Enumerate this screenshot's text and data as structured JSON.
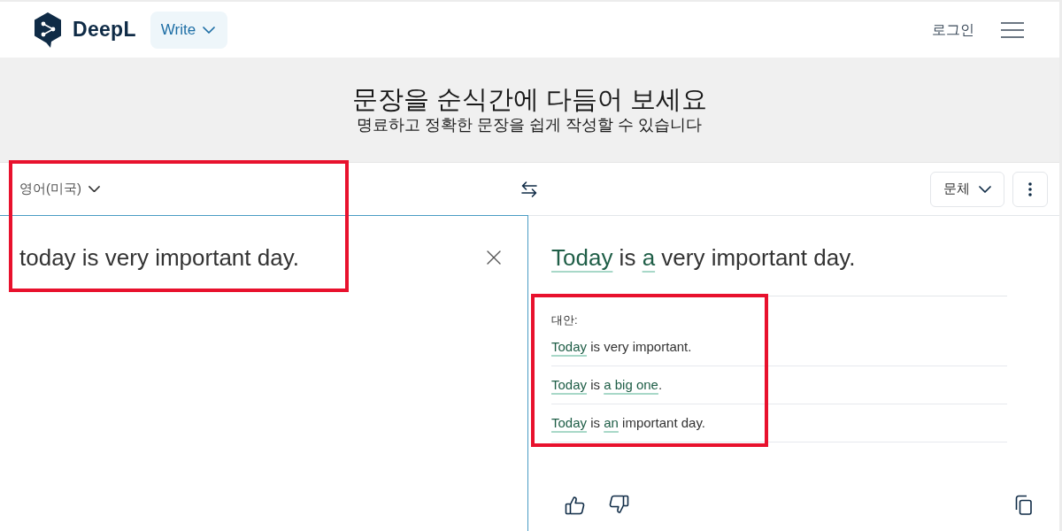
{
  "header": {
    "logo_text": "DeepL",
    "mode_button": "Write",
    "login": "로그인"
  },
  "hero": {
    "title": "문장을 순식간에 다듬어 보세요",
    "subtitle": "명료하고 정확한 문장을 쉽게 작성할 수 있습니다"
  },
  "source": {
    "language": "영어(미국)",
    "text": "today is very important day.",
    "highlighted": true
  },
  "result": {
    "style_button": "문체",
    "sentence": [
      {
        "text": "Today",
        "changed": true
      },
      {
        "text": " is ",
        "changed": false
      },
      {
        "text": "a",
        "changed": true
      },
      {
        "text": " very important day.",
        "changed": false
      }
    ]
  },
  "alternatives": {
    "label": "대안:",
    "highlighted": true,
    "items": [
      {
        "segments": [
          {
            "text": "Today",
            "changed": true
          },
          {
            "text": " is very important.",
            "changed": false
          }
        ]
      },
      {
        "segments": [
          {
            "text": "Today",
            "changed": true
          },
          {
            "text": " is ",
            "changed": false
          },
          {
            "text": "a big one",
            "changed": true
          },
          {
            "text": ".",
            "changed": false
          }
        ]
      },
      {
        "segments": [
          {
            "text": "Today",
            "changed": true
          },
          {
            "text": " is ",
            "changed": false
          },
          {
            "text": "an",
            "changed": true
          },
          {
            "text": " important day.",
            "changed": false
          }
        ]
      }
    ]
  }
}
